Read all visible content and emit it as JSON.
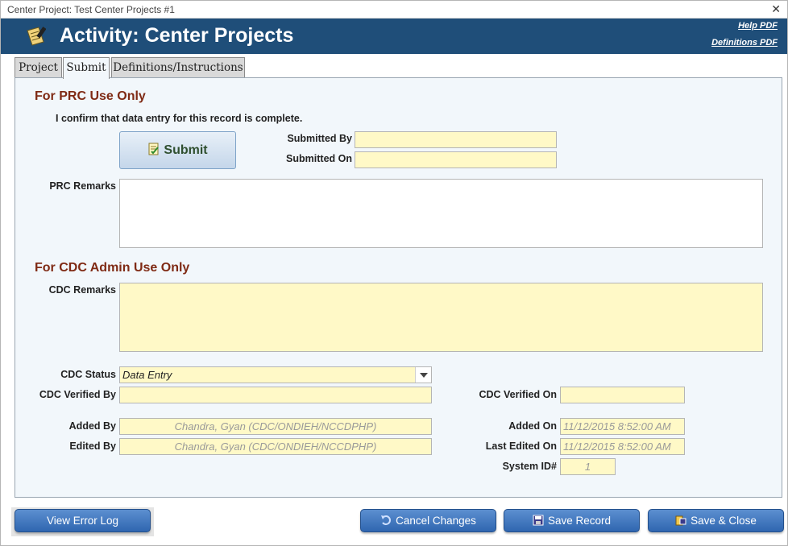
{
  "window": {
    "title": "Center Project: Test Center Projects #1",
    "close": "✕"
  },
  "header": {
    "title": "Activity: Center Projects",
    "help_link": "Help PDF",
    "definitions_link": "Definitions PDF"
  },
  "tabs": [
    {
      "label": "Project"
    },
    {
      "label": "Submit"
    },
    {
      "label": "Definitions/Instructions"
    }
  ],
  "prc": {
    "section_title": "For PRC Use Only",
    "confirm_note": "I confirm that data entry for this record is complete.",
    "submit_button": "Submit",
    "submitted_by_label": "Submitted By",
    "submitted_by_value": "",
    "submitted_on_label": "Submitted On",
    "submitted_on_value": "",
    "remarks_label": "PRC Remarks",
    "remarks_value": ""
  },
  "cdc": {
    "section_title": "For CDC Admin Use Only",
    "remarks_label": "CDC Remarks",
    "remarks_value": "",
    "status_label": "CDC Status",
    "status_value": "Data Entry",
    "verified_by_label": "CDC Verified By",
    "verified_by_value": "",
    "verified_on_label": "CDC Verified On",
    "verified_on_value": ""
  },
  "audit": {
    "added_by_label": "Added By",
    "added_by_value": "Chandra, Gyan (CDC/ONDIEH/NCCDPHP)",
    "edited_by_label": "Edited By",
    "edited_by_value": "Chandra, Gyan (CDC/ONDIEH/NCCDPHP)",
    "added_on_label": "Added On",
    "added_on_value": "11/12/2015 8:52:00 AM",
    "last_edited_on_label": "Last Edited On",
    "last_edited_on_value": "11/12/2015 8:52:00 AM",
    "system_id_label": "System ID#",
    "system_id_value": "1"
  },
  "footer": {
    "view_error_log": "View Error Log",
    "cancel_changes": "Cancel Changes",
    "save_record": "Save Record",
    "save_close": "Save & Close"
  },
  "colors": {
    "header_bg": "#1f4e79",
    "section_title": "#7f2a14",
    "field_bg": "#fff9c7",
    "button_bg": "#2f66b0"
  }
}
